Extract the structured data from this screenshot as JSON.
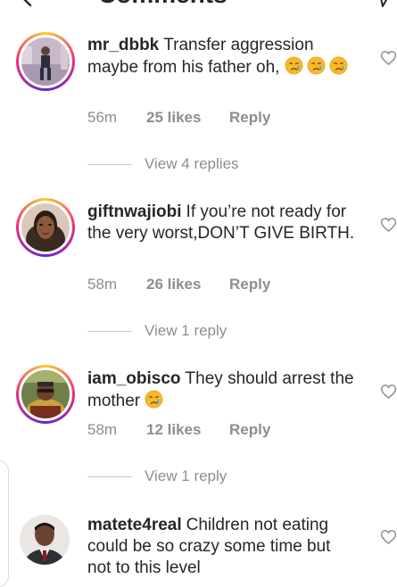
{
  "header": {
    "title": "Comments"
  },
  "comments": [
    {
      "username": "mr_dbbk",
      "text": "Transfer aggression maybe from his father oh,",
      "time": "56m",
      "likes": "25 likes",
      "reply": "Reply",
      "view_replies": "View 4 replies",
      "emoji_icon": "crying-face-emoji"
    },
    {
      "username": "giftnwajiobi",
      "text": "If you’re not ready for the very worst,DON’T GIVE BIRTH.",
      "time": "58m",
      "likes": "26 likes",
      "reply": "Reply",
      "view_replies": "View 1 reply"
    },
    {
      "username": "iam_obisco",
      "text": "They should arrest the mother",
      "time": "58m",
      "likes": "12 likes",
      "reply": "Reply",
      "view_replies": "View 1 reply",
      "emoji_icon": "crying-face-emoji"
    },
    {
      "username": "matete4real",
      "text": "Children not eating could be so crazy some time but not to this level"
    }
  ],
  "colors": {
    "muted": "#8e8e8e",
    "text": "#262626",
    "story_ring": "#ee2a7b"
  }
}
